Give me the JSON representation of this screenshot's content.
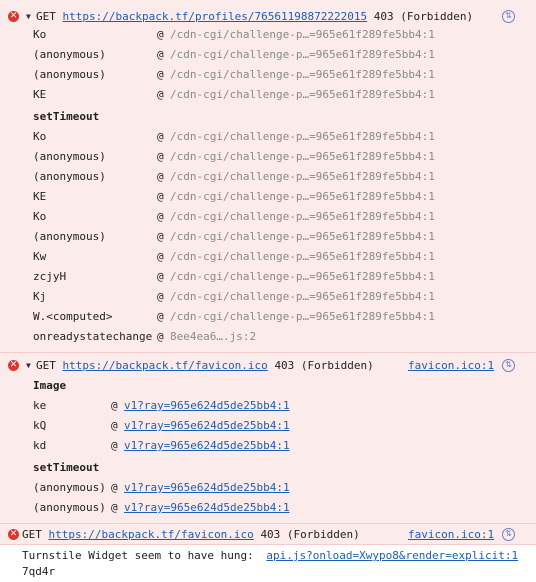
{
  "entry1": {
    "method": "GET",
    "url": "https://backpack.tf/profiles/76561198872222015",
    "status": "403 (Forbidden)",
    "frames": [
      {
        "fn": "Ko",
        "loc": "/cdn-cgi/challenge-p…=965e61f289fe5bb4:1"
      },
      {
        "fn": "(anonymous)",
        "loc": "/cdn-cgi/challenge-p…=965e61f289fe5bb4:1"
      },
      {
        "fn": "(anonymous)",
        "loc": "/cdn-cgi/challenge-p…=965e61f289fe5bb4:1"
      },
      {
        "fn": "KE",
        "loc": "/cdn-cgi/challenge-p…=965e61f289fe5bb4:1"
      }
    ],
    "group_label": "setTimeout",
    "frames2": [
      {
        "fn": "Ko",
        "loc": "/cdn-cgi/challenge-p…=965e61f289fe5bb4:1"
      },
      {
        "fn": "(anonymous)",
        "loc": "/cdn-cgi/challenge-p…=965e61f289fe5bb4:1"
      },
      {
        "fn": "(anonymous)",
        "loc": "/cdn-cgi/challenge-p…=965e61f289fe5bb4:1"
      },
      {
        "fn": "KE",
        "loc": "/cdn-cgi/challenge-p…=965e61f289fe5bb4:1"
      },
      {
        "fn": "Ko",
        "loc": "/cdn-cgi/challenge-p…=965e61f289fe5bb4:1"
      },
      {
        "fn": "(anonymous)",
        "loc": "/cdn-cgi/challenge-p…=965e61f289fe5bb4:1"
      },
      {
        "fn": "Kw",
        "loc": "/cdn-cgi/challenge-p…=965e61f289fe5bb4:1"
      },
      {
        "fn": "zcjyH",
        "loc": "/cdn-cgi/challenge-p…=965e61f289fe5bb4:1"
      },
      {
        "fn": "Kj",
        "loc": "/cdn-cgi/challenge-p…=965e61f289fe5bb4:1"
      },
      {
        "fn": "W.<computed>",
        "loc": "/cdn-cgi/challenge-p…=965e61f289fe5bb4:1"
      },
      {
        "fn": "onreadystatechange",
        "loc": "8ee4ea6….js:2"
      }
    ]
  },
  "entry2": {
    "method": "GET",
    "url": "https://backpack.tf/favicon.ico",
    "status": "403 (Forbidden)",
    "source": "favicon.ico:1",
    "group1": "Image",
    "frames": [
      {
        "fn": "ke",
        "loc": "v1?ray=965e624d5de25bb4:1"
      },
      {
        "fn": "kQ",
        "loc": "v1?ray=965e624d5de25bb4:1"
      },
      {
        "fn": "kd",
        "loc": "v1?ray=965e624d5de25bb4:1"
      }
    ],
    "group2": "setTimeout",
    "frames2": [
      {
        "fn": "(anonymous)",
        "loc": "v1?ray=965e624d5de25bb4:1"
      },
      {
        "fn": "(anonymous)",
        "loc": "v1?ray=965e624d5de25bb4:1"
      }
    ]
  },
  "entry3": {
    "method": "GET",
    "url": "https://backpack.tf/favicon.ico",
    "status": "403 (Forbidden)",
    "source": "favicon.ico:1"
  },
  "entry4": {
    "message": "Turnstile Widget seem to have hung:",
    "source": "api.js?onload=Xwypo8&render=explicit:1",
    "tail": "7qd4r"
  },
  "icons": {
    "error": "error-circle-icon",
    "network": "network-request-icon",
    "expand": "triangle-down-icon"
  },
  "colors": {
    "error_bg": "#fcebeb",
    "error_icon": "#dc362e",
    "link": "#1a5fb4",
    "gray": "#8a8a8a"
  }
}
